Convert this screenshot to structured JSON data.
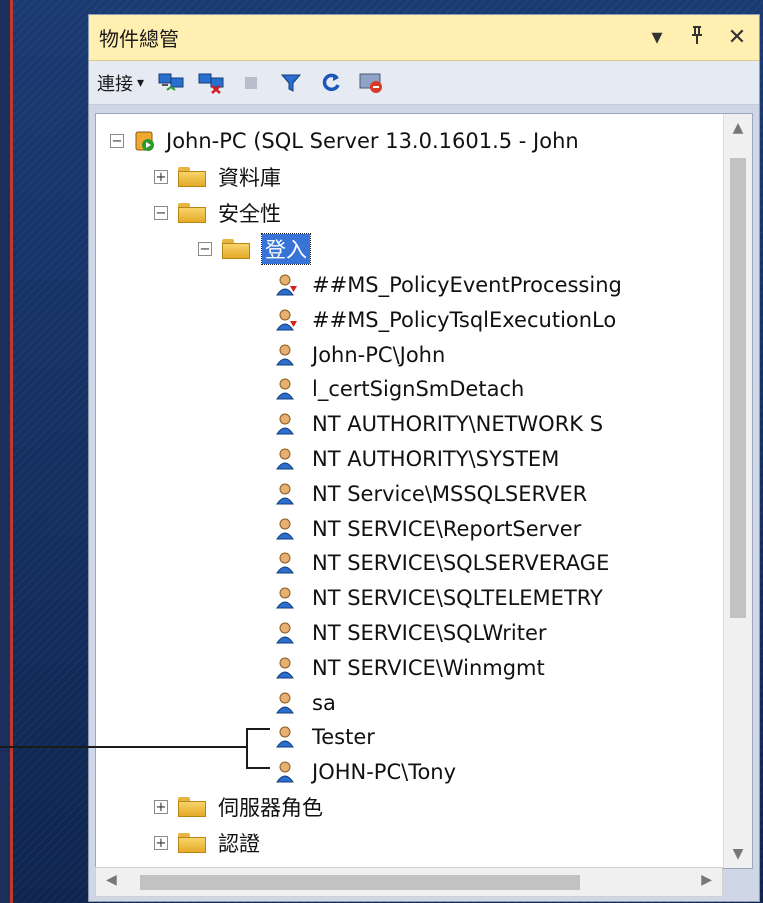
{
  "window": {
    "title": "物件總管",
    "dropdown_icon": "▾",
    "pin_icon": "pin-icon",
    "close_icon": "✕"
  },
  "toolbar": {
    "connect_label": "連接",
    "connect_arrow": "▾",
    "icons": [
      "connect-icon",
      "disconnect-icon",
      "stop-icon",
      "filter-icon",
      "refresh-icon",
      "activity-icon"
    ]
  },
  "tree": {
    "server": {
      "label": "John-PC (SQL Server 13.0.1601.5 - John",
      "expander": "−"
    },
    "databases": {
      "label": "資料庫",
      "expander": "+"
    },
    "security": {
      "label": "安全性",
      "expander": "−"
    },
    "logins_folder": {
      "label": "登入",
      "expander": "−"
    },
    "logins": [
      {
        "label": "##MS_PolicyEventProcessing",
        "disabled": true
      },
      {
        "label": "##MS_PolicyTsqlExecutionLo",
        "disabled": true
      },
      {
        "label": "John-PC\\John",
        "disabled": false
      },
      {
        "label": "l_certSignSmDetach",
        "disabled": false
      },
      {
        "label": "NT AUTHORITY\\NETWORK S",
        "disabled": false
      },
      {
        "label": "NT AUTHORITY\\SYSTEM",
        "disabled": false
      },
      {
        "label": "NT Service\\MSSQLSERVER",
        "disabled": false
      },
      {
        "label": "NT SERVICE\\ReportServer",
        "disabled": false
      },
      {
        "label": "NT SERVICE\\SQLSERVERAGE",
        "disabled": false
      },
      {
        "label": "NT SERVICE\\SQLTELEMETRY",
        "disabled": false
      },
      {
        "label": "NT SERVICE\\SQLWriter",
        "disabled": false
      },
      {
        "label": "NT SERVICE\\Winmgmt",
        "disabled": false
      },
      {
        "label": "sa",
        "disabled": false
      },
      {
        "label": "Tester",
        "disabled": false
      },
      {
        "label": "JOHN-PC\\Tony",
        "disabled": false
      }
    ],
    "server_roles": {
      "label": "伺服器角色",
      "expander": "+"
    },
    "credentials": {
      "label": "認證",
      "expander": "+"
    }
  },
  "colors": {
    "titlebar_bg": "#ffefb0",
    "selection": "#3874d8",
    "background": "#17305e"
  }
}
